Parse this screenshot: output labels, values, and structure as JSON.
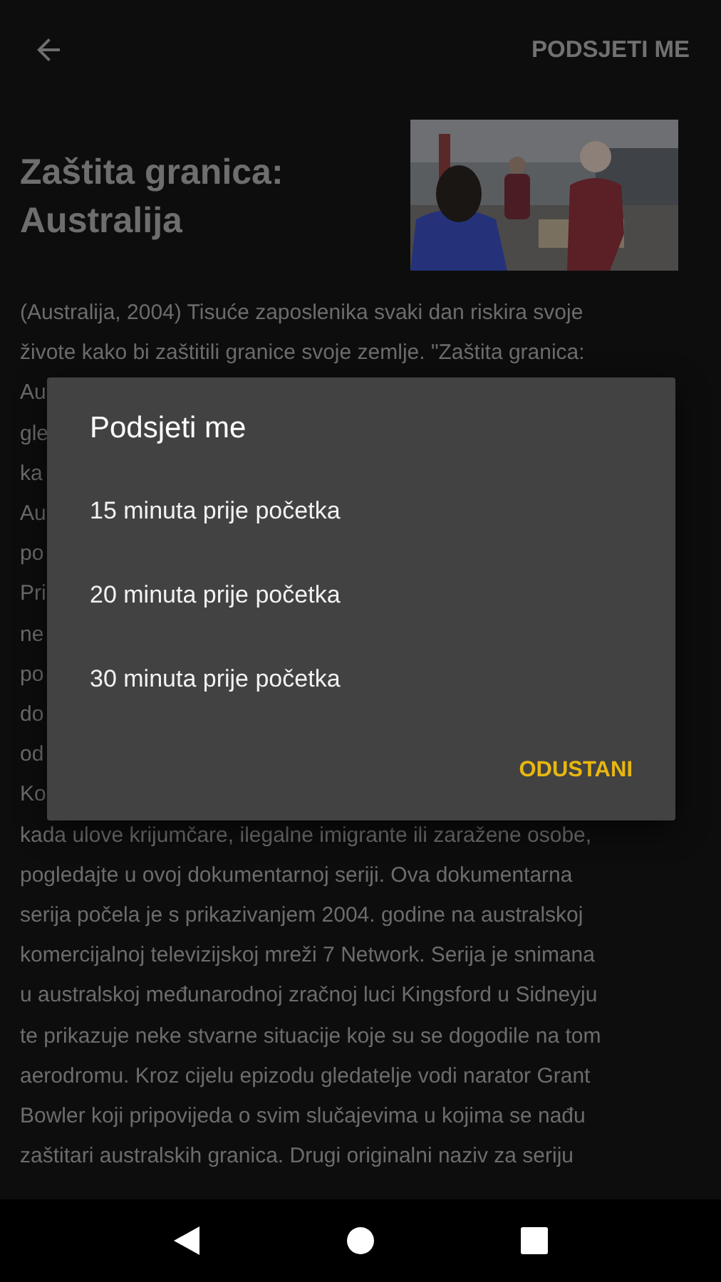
{
  "app_bar": {
    "action": "PODSJETI ME"
  },
  "program": {
    "title": "Zaštita granica: Australija",
    "description_lines": [
      "(Australija, 2004) Tisuće zaposlenika svaki dan riskira svoje",
      "živote kako bi zaštitili granice svoje zemlje. \"Zaštita granica:",
      "Au",
      "gle",
      "ka",
      "Au",
      "po",
      "Pri",
      "ne",
      "po",
      "do",
      "od",
      "Ko",
      "kada ulove krijumčare, ilegalne imigrante ili zaražene osobe,",
      "pogledajte u ovoj dokumentarnoj seriji. Ova dokumentarna",
      "serija počela je s prikazivanjem 2004. godine na australskoj",
      "komercijalnoj televizijskoj mreži 7 Network. Serija je snimana",
      "u australskoj međunarodnoj zračnoj luci Kingsford u Sidneyju",
      "te prikazuje neke stvarne situacije koje su se dogodile na tom",
      "aerodromu. Kroz cijelu epizodu gledatelje vodi narator Grant",
      "Bowler koji pripovijeda o svim slučajevima u kojima se nađu",
      "zaštitari australskih granica. Drugi originalni naziv za seriju"
    ]
  },
  "dialog": {
    "title": "Podsjeti me",
    "options": [
      "15 minuta prije početka",
      "20 minuta prije početka",
      "30 minuta prije početka"
    ],
    "cancel": "ODUSTANI"
  }
}
